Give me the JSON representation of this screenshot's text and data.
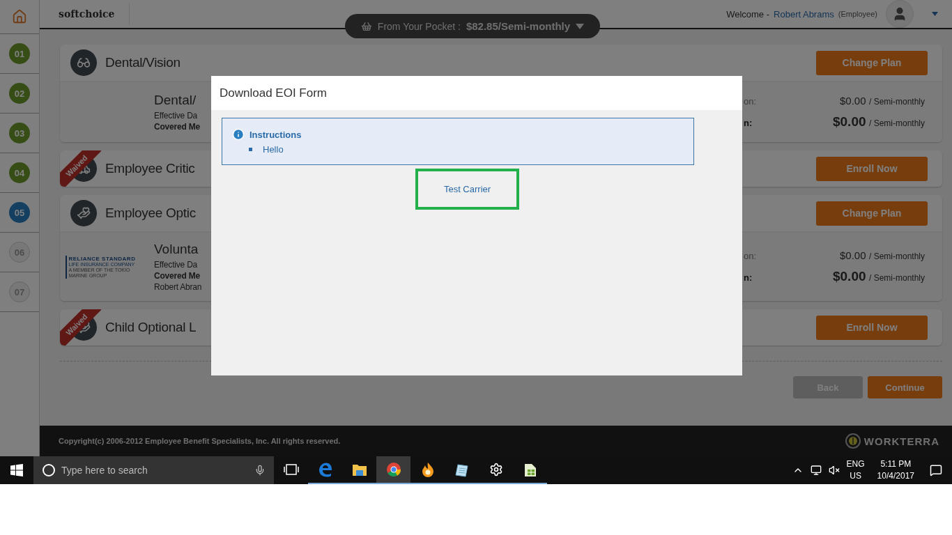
{
  "header": {
    "logo": "softchoice",
    "welcome_label": "Welcome -",
    "user_name": "Robert Abrams",
    "user_role": "(Employee)"
  },
  "pocket": {
    "label": "From Your Pocket :",
    "amount": "$82.85/Semi-monthly"
  },
  "steps": [
    {
      "label": "01",
      "kind": "done"
    },
    {
      "label": "02",
      "kind": "done"
    },
    {
      "label": "03",
      "kind": "done"
    },
    {
      "label": "04",
      "kind": "done"
    },
    {
      "label": "05",
      "kind": "current"
    },
    {
      "label": "06",
      "kind": "todo"
    },
    {
      "label": "07",
      "kind": "todo"
    }
  ],
  "cards": [
    {
      "title": "Dental/Vision",
      "waived": false,
      "button": "Change Plan",
      "details": {
        "plan": "Dental/",
        "lines": [
          {
            "text": "Effective Da",
            "bold": false
          },
          {
            "text": "Covered Me",
            "bold": true
          }
        ],
        "costs": [
          {
            "label": "on:",
            "amount": "$0.00",
            "period": "/ Semi-monthly",
            "total": false
          },
          {
            "label": "n:",
            "amount": "$0.00",
            "period": "/ Semi-monthly",
            "total": true
          }
        ]
      }
    },
    {
      "title": "Employee Critic",
      "waived": true,
      "badge": "Waived",
      "button": "Enroll Now"
    },
    {
      "title": "Employee Optic",
      "waived": false,
      "button": "Change Plan",
      "details": {
        "carrier_logo": {
          "name": "RELIANCE STANDARD",
          "sub": "LIFE INSURANCE COMPANY",
          "tagline": "A MEMBER OF THE TOKIO MARINE GROUP"
        },
        "plan": "Volunta",
        "lines": [
          {
            "text": "Effective Da",
            "bold": false
          },
          {
            "text": "Covered Me",
            "bold": true
          },
          {
            "text": "Robert Abran",
            "bold": false
          }
        ],
        "costs": [
          {
            "label": "on:",
            "amount": "$0.00",
            "period": "/ Semi-monthly",
            "total": false
          },
          {
            "label": "n:",
            "amount": "$0.00",
            "period": "/ Semi-monthly",
            "total": true
          }
        ]
      }
    },
    {
      "title": "Child Optional L",
      "waived": true,
      "badge": "Waived",
      "button": "Enroll Now"
    }
  ],
  "actions": [
    {
      "label": "Back",
      "kind": "secondary"
    },
    {
      "label": "Continue",
      "kind": "primary"
    }
  ],
  "footer": {
    "copyright": "Copyright(c) 2006-2012 Employee Benefit Specialists, Inc. All rights reserved.",
    "brand": "WORKTERRA"
  },
  "modal": {
    "title": "Download EOI Form",
    "instructions": {
      "heading": "Instructions",
      "items": [
        "Hello"
      ]
    },
    "carrier_link": {
      "label": "Test Carrier",
      "highlighted": true
    }
  },
  "taskbar": {
    "search_placeholder": "Type here to search",
    "apps": [
      {
        "kind": "task-view",
        "running": false,
        "active": false
      },
      {
        "kind": "edge",
        "running": true,
        "active": false
      },
      {
        "kind": "folder",
        "running": true,
        "active": false
      },
      {
        "kind": "chrome",
        "running": true,
        "active": true
      },
      {
        "kind": "flame",
        "running": true,
        "active": false
      },
      {
        "kind": "notepad",
        "running": true,
        "active": false
      },
      {
        "kind": "settings",
        "running": true,
        "active": false
      },
      {
        "kind": "sheet",
        "running": true,
        "active": false
      }
    ],
    "language": "ENG",
    "region": "US",
    "time": "5:11 PM",
    "date": "10/4/2017"
  }
}
